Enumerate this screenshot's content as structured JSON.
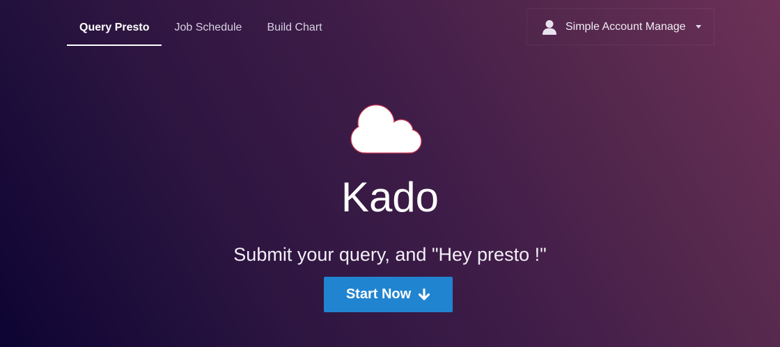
{
  "nav": {
    "tabs": [
      {
        "label": "Query Presto",
        "active": true
      },
      {
        "label": "Job Schedule",
        "active": false
      },
      {
        "label": "Build Chart",
        "active": false
      }
    ],
    "account": {
      "label": "Simple Account Manage",
      "icon": "user-icon",
      "dropdown_icon": "caret-down-icon"
    }
  },
  "hero": {
    "icon": "cloud-icon",
    "title": "Kado",
    "tagline": "Submit your query, and \"Hey presto !\"",
    "cta": {
      "label": "Start Now",
      "icon": "arrow-down-icon"
    }
  },
  "colors": {
    "background_start": "#0d0433",
    "background_end": "#6d3157",
    "button": "#2184d1",
    "text": "#ffffff"
  }
}
